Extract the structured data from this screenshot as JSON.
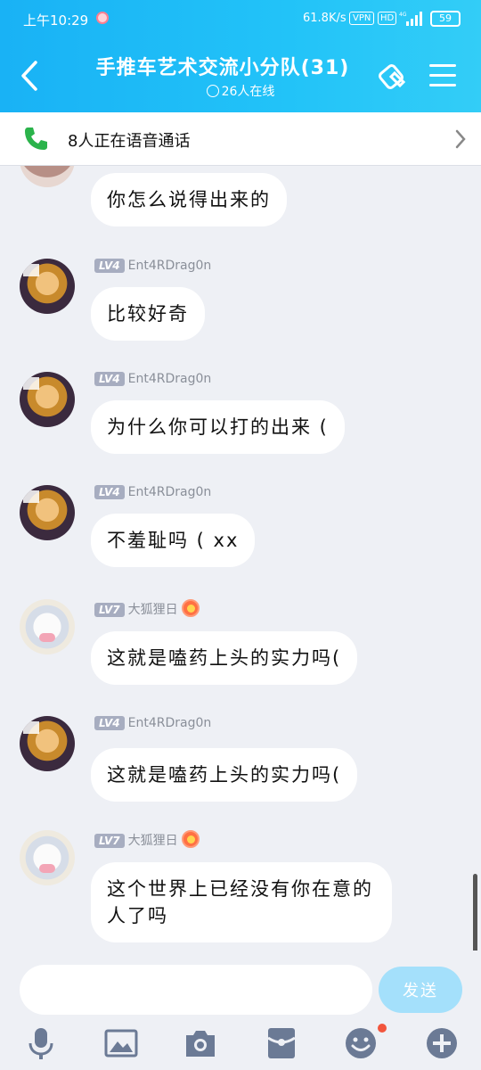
{
  "status_bar": {
    "time": "上午10:29",
    "speed": "61.8K/s",
    "vpn": "VPN",
    "hd": "HD",
    "network": "4G",
    "battery": "59"
  },
  "header": {
    "title": "手推车艺术交流小分队(31)",
    "online": "26人在线",
    "icons": [
      "back-icon",
      "session-icon",
      "menu-icon"
    ]
  },
  "voice_banner": {
    "text": "8人正在语音通话"
  },
  "messages": [
    {
      "sender": "",
      "level": "",
      "text": "你怎么说得出来的",
      "avatar": "partial"
    },
    {
      "sender": "Ent4RDrag0n",
      "level": "LV4",
      "text": "比较好奇",
      "avatar": "dragon"
    },
    {
      "sender": "Ent4RDrag0n",
      "level": "LV4",
      "text": "为什么你可以打的出来 (",
      "avatar": "dragon"
    },
    {
      "sender": "Ent4RDrag0n",
      "level": "LV4",
      "text": "不羞耻吗 ( xx",
      "avatar": "dragon"
    },
    {
      "sender": "大狐狸日",
      "level": "LV7",
      "text": "这就是嗑药上头的实力吗(",
      "avatar": "fox"
    },
    {
      "sender": "Ent4RDrag0n",
      "level": "LV4",
      "text": "这就是嗑药上头的实力吗(",
      "avatar": "dragon"
    },
    {
      "sender": "大狐狸日",
      "level": "LV7",
      "text": "这个世界上已经没有你在意的人了吗",
      "avatar": "fox"
    }
  ],
  "input": {
    "value": "",
    "send_label": "发送"
  },
  "toolbar": {
    "icons": [
      "microphone-icon",
      "image-icon",
      "camera-icon",
      "red-packet-icon",
      "emoji-icon",
      "plus-icon"
    ]
  },
  "colors": {
    "header": "#22c3f8",
    "send_button": "#a4e0fb",
    "level_badge": "#a7adc0",
    "background": "#eef0f5"
  }
}
